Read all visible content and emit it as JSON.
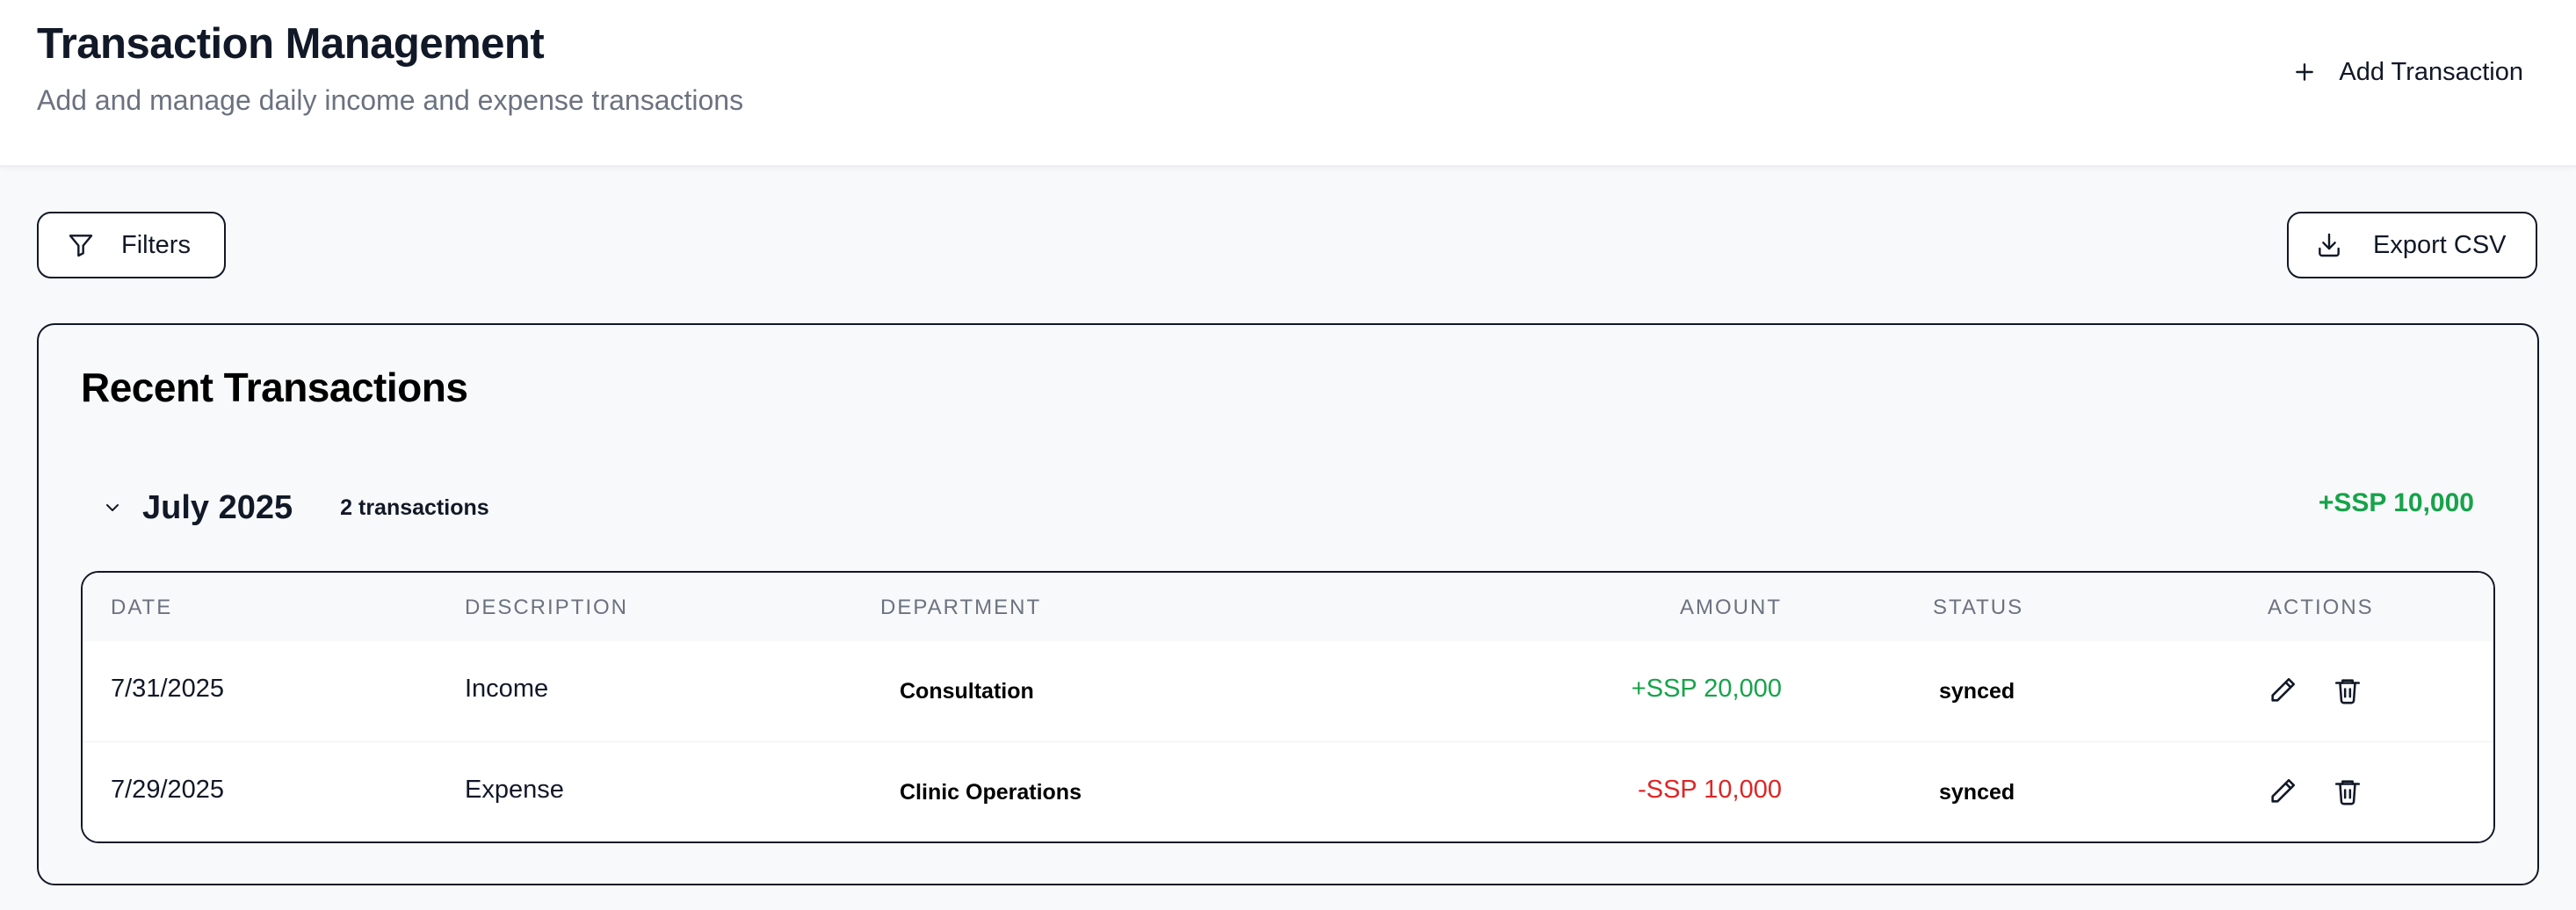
{
  "header": {
    "title": "Transaction Management",
    "subtitle": "Add and manage daily income and expense transactions",
    "add_button": {
      "label": "Add Transaction",
      "icon": "plus-icon"
    }
  },
  "toolbar": {
    "filters_button": {
      "label": "Filters",
      "icon": "filter-icon"
    },
    "export_button": {
      "label": "Export CSV",
      "icon": "download-icon"
    }
  },
  "card": {
    "title": "Recent Transactions",
    "group": {
      "title": "July 2025",
      "count_label": "2 transactions",
      "total": "+SSP 10,000",
      "expanded": true
    }
  },
  "table": {
    "columns": {
      "date": "DATE",
      "description": "DESCRIPTION",
      "department": "DEPARTMENT",
      "amount": "AMOUNT",
      "status": "STATUS",
      "actions": "ACTIONS"
    },
    "rows": [
      {
        "date": "7/31/2025",
        "description": "Income",
        "department": "Consultation",
        "amount": "+SSP 20,000",
        "amount_type": "income",
        "status": "synced"
      },
      {
        "date": "7/29/2025",
        "description": "Expense",
        "department": "Clinic Operations",
        "amount": "-SSP 10,000",
        "amount_type": "expense",
        "status": "synced"
      }
    ],
    "action_icons": [
      "pencil-icon",
      "trash-icon"
    ]
  },
  "colors": {
    "income": "#16a34a",
    "expense": "#dc2626",
    "text_primary": "#111827",
    "text_muted": "#6b7280",
    "background": "#f8f9fa"
  }
}
